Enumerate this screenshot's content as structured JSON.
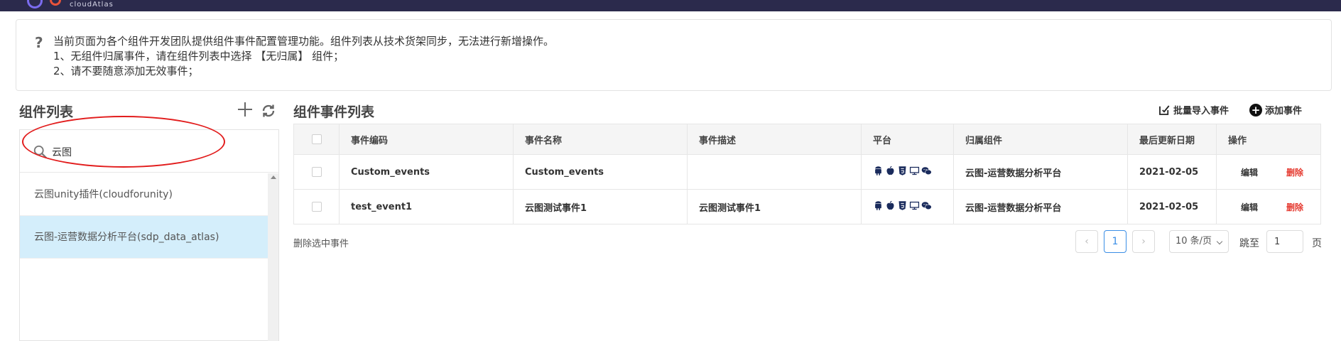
{
  "header": {
    "brand": "cloudAtlas"
  },
  "notice": {
    "line1": "当前页面为各个组件开发团队提供组件事件配置管理功能。组件列表从技术货架同步，无法进行新增操作。",
    "line2": "1、无组件归属事件，请在组件列表中选择 【无归属】 组件；",
    "line3": "2、请不要随意添加无效事件；"
  },
  "left": {
    "title": "组件列表",
    "search_value": "云图",
    "items": [
      {
        "label": "云图unity插件(cloudforunity)"
      },
      {
        "label": "云图-运营数据分析平台(sdp_data_atlas)"
      }
    ]
  },
  "right": {
    "title": "组件事件列表",
    "batch_import_label": "批量导入事件",
    "add_event_label": "添加事件",
    "columns": [
      "事件编码",
      "事件名称",
      "事件描述",
      "平台",
      "归属组件",
      "最后更新日期",
      "操作"
    ],
    "rows": [
      {
        "code": "Custom_events",
        "name": "Custom_events",
        "desc": "",
        "component": "云图-运营数据分析平台",
        "date": "2021-02-05",
        "edit": "编辑",
        "delete": "删除"
      },
      {
        "code": "test_event1",
        "name": "云图测试事件1",
        "desc": "云图测试事件1",
        "component": "云图-运营数据分析平台",
        "date": "2021-02-05",
        "edit": "编辑",
        "delete": "删除"
      }
    ],
    "platform_icons": [
      "android-icon",
      "apple-icon",
      "html5-icon",
      "desktop-icon",
      "wechat-icon"
    ]
  },
  "footer": {
    "delete_selected": "删除选中事件",
    "current_page": "1",
    "page_size": "10 条/页",
    "goto_label": "跳至",
    "goto_value": "1",
    "page_suffix": "页"
  },
  "colors": {
    "accent": "#3a8ee6",
    "danger": "#e5392f",
    "active_row": "#d4eefb",
    "annotation": "#e21c1c"
  }
}
